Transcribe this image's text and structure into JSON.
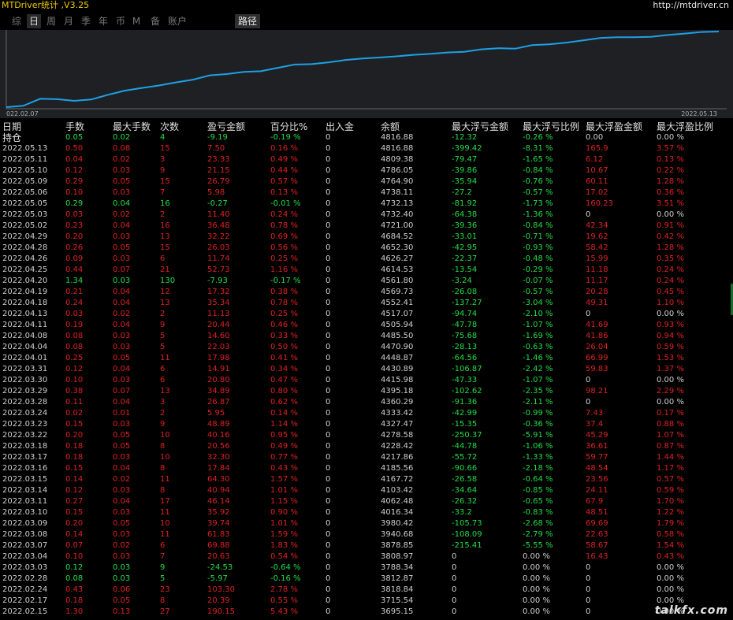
{
  "app": {
    "title": "MTDriver统计 ,V3.25",
    "site": "http://mtdriver.cn"
  },
  "tabs": [
    {
      "label": "综",
      "active": false
    },
    {
      "label": "日",
      "active": true
    },
    {
      "label": "周",
      "active": false
    },
    {
      "label": "月",
      "active": false
    },
    {
      "label": "季",
      "active": false
    },
    {
      "label": "年",
      "active": false
    },
    {
      "label": "币",
      "active": false
    },
    {
      "label": "M",
      "active": false
    },
    {
      "label": "备",
      "active": false
    },
    {
      "label": "账户",
      "active": false
    },
    {
      "label": "路径",
      "active": false
    }
  ],
  "chart_data": {
    "type": "line",
    "x_start_label": "022.02.07",
    "x_end_label": "2022.05.13",
    "line_color": "#1ea0e6",
    "background": "#1e2024",
    "values": [
      3695.15,
      3715.54,
      3818.84,
      3812.87,
      3788.34,
      3808.97,
      3878.85,
      3940.68,
      3980.42,
      4016.34,
      4062.48,
      4103.42,
      4167.72,
      4185.56,
      4217.86,
      4228.42,
      4278.58,
      4327.47,
      4333.42,
      4360.29,
      4395.18,
      4415.98,
      4430.89,
      4448.87,
      4470.9,
      4485.5,
      4505.94,
      4517.07,
      4552.41,
      4569.73,
      4561.8,
      4614.53,
      4626.27,
      4652.3,
      4684.52,
      4721.0,
      4732.4,
      4732.13,
      4738.11,
      4764.9,
      4786.05,
      4809.38,
      4816.88
    ]
  },
  "table": {
    "headers": [
      "日期",
      "手数",
      "最大手数",
      "次数",
      "盈亏金额",
      "百分比%",
      "出入金",
      "余额",
      "最大浮亏金额",
      "最大浮亏比例",
      "最大浮盈金额",
      "最大浮盈比例"
    ],
    "holding": {
      "date": "持仓",
      "lots": "0.05",
      "max_lots": "0.02",
      "count": "4",
      "pnl": "-9.19",
      "pct": "-0.19 %",
      "flow": "0",
      "balance": "4816.88",
      "max_dd": "-12.32",
      "max_dd_pct": "-0.26 %",
      "max_fp": "0.00",
      "max_fp_pct": "0.00 %",
      "sign": "neg"
    },
    "rows": [
      {
        "date": "2022.05.13",
        "lots": "0.50",
        "max_lots": "0.08",
        "count": "15",
        "pnl": "7.50",
        "pct": "0.16 %",
        "flow": "0",
        "balance": "4816.88",
        "max_dd": "-399.42",
        "max_dd_pct": "-8.31 %",
        "max_fp": "165.9",
        "max_fp_pct": "3.57 %",
        "sign": "pos",
        "fp_sign": "pos"
      },
      {
        "date": "2022.05.11",
        "lots": "0.04",
        "max_lots": "0.02",
        "count": "3",
        "pnl": "23.33",
        "pct": "0.49 %",
        "flow": "0",
        "balance": "4809.38",
        "max_dd": "-79.47",
        "max_dd_pct": "-1.65 %",
        "max_fp": "6.12",
        "max_fp_pct": "0.13 %",
        "sign": "pos",
        "fp_sign": "pos"
      },
      {
        "date": "2022.05.10",
        "lots": "0.12",
        "max_lots": "0.03",
        "count": "9",
        "pnl": "21.15",
        "pct": "0.44 %",
        "flow": "0",
        "balance": "4786.05",
        "max_dd": "-39.86",
        "max_dd_pct": "-0.84 %",
        "max_fp": "10.67",
        "max_fp_pct": "0.22 %",
        "sign": "pos",
        "fp_sign": "pos"
      },
      {
        "date": "2022.05.09",
        "lots": "0.29",
        "max_lots": "0.05",
        "count": "15",
        "pnl": "26.79",
        "pct": "0.57 %",
        "flow": "0",
        "balance": "4764.90",
        "max_dd": "-35.94",
        "max_dd_pct": "-0.76 %",
        "max_fp": "60.11",
        "max_fp_pct": "1.28 %",
        "sign": "pos",
        "fp_sign": "pos"
      },
      {
        "date": "2022.05.06",
        "lots": "0.10",
        "max_lots": "0.03",
        "count": "7",
        "pnl": "5.98",
        "pct": "0.13 %",
        "flow": "0",
        "balance": "4738.11",
        "max_dd": "-27.2",
        "max_dd_pct": "-0.57 %",
        "max_fp": "17.02",
        "max_fp_pct": "0.36 %",
        "sign": "pos",
        "fp_sign": "pos"
      },
      {
        "date": "2022.05.05",
        "lots": "0.29",
        "max_lots": "0.04",
        "count": "16",
        "pnl": "-0.27",
        "pct": "-0.01 %",
        "flow": "0",
        "balance": "4732.13",
        "max_dd": "-81.92",
        "max_dd_pct": "-1.73 %",
        "max_fp": "160.23",
        "max_fp_pct": "3.51 %",
        "sign": "neg",
        "fp_sign": "pos"
      },
      {
        "date": "2022.05.03",
        "lots": "0.03",
        "max_lots": "0.02",
        "count": "2",
        "pnl": "11.40",
        "pct": "0.24 %",
        "flow": "0",
        "balance": "4732.40",
        "max_dd": "-64.38",
        "max_dd_pct": "-1.36 %",
        "max_fp": "0",
        "max_fp_pct": "0.00 %",
        "sign": "pos",
        "fp_sign": "neu"
      },
      {
        "date": "2022.05.02",
        "lots": "0.23",
        "max_lots": "0.04",
        "count": "16",
        "pnl": "36.48",
        "pct": "0.78 %",
        "flow": "0",
        "balance": "4721.00",
        "max_dd": "-39.36",
        "max_dd_pct": "-0.84 %",
        "max_fp": "42.34",
        "max_fp_pct": "0.91 %",
        "sign": "pos",
        "fp_sign": "pos"
      },
      {
        "date": "2022.04.29",
        "lots": "0.20",
        "max_lots": "0.03",
        "count": "13",
        "pnl": "32.22",
        "pct": "0.69 %",
        "flow": "0",
        "balance": "4684.52",
        "max_dd": "-33.01",
        "max_dd_pct": "-0.71 %",
        "max_fp": "19.62",
        "max_fp_pct": "0.42 %",
        "sign": "pos",
        "fp_sign": "pos"
      },
      {
        "date": "2022.04.28",
        "lots": "0.26",
        "max_lots": "0.05",
        "count": "15",
        "pnl": "26.03",
        "pct": "0.56 %",
        "flow": "0",
        "balance": "4652.30",
        "max_dd": "-42.95",
        "max_dd_pct": "-0.93 %",
        "max_fp": "58.42",
        "max_fp_pct": "1.28 %",
        "sign": "pos",
        "fp_sign": "pos"
      },
      {
        "date": "2022.04.26",
        "lots": "0.09",
        "max_lots": "0.03",
        "count": "6",
        "pnl": "11.74",
        "pct": "0.25 %",
        "flow": "0",
        "balance": "4626.27",
        "max_dd": "-22.37",
        "max_dd_pct": "-0.48 %",
        "max_fp": "15.99",
        "max_fp_pct": "0.35 %",
        "sign": "pos",
        "fp_sign": "pos"
      },
      {
        "date": "2022.04.25",
        "lots": "0.44",
        "max_lots": "0.07",
        "count": "21",
        "pnl": "52.73",
        "pct": "1.16 %",
        "flow": "0",
        "balance": "4614.53",
        "max_dd": "-13.54",
        "max_dd_pct": "-0.29 %",
        "max_fp": "11.18",
        "max_fp_pct": "0.24 %",
        "sign": "pos",
        "fp_sign": "pos"
      },
      {
        "date": "2022.04.20",
        "lots": "1.34",
        "max_lots": "0.03",
        "count": "130",
        "pnl": "-7.93",
        "pct": "-0.17 %",
        "flow": "0",
        "balance": "4561.80",
        "max_dd": "-3.24",
        "max_dd_pct": "-0.07 %",
        "max_fp": "11.17",
        "max_fp_pct": "0.24 %",
        "sign": "neg",
        "fp_sign": "pos"
      },
      {
        "date": "2022.04.19",
        "lots": "0.21",
        "max_lots": "0.04",
        "count": "12",
        "pnl": "17.32",
        "pct": "0.38 %",
        "flow": "0",
        "balance": "4569.73",
        "max_dd": "-26.08",
        "max_dd_pct": "-0.57 %",
        "max_fp": "20.28",
        "max_fp_pct": "0.45 %",
        "sign": "pos",
        "fp_sign": "pos"
      },
      {
        "date": "2022.04.18",
        "lots": "0.24",
        "max_lots": "0.04",
        "count": "13",
        "pnl": "35.34",
        "pct": "0.78 %",
        "flow": "0",
        "balance": "4552.41",
        "max_dd": "-137.27",
        "max_dd_pct": "-3.04 %",
        "max_fp": "49.31",
        "max_fp_pct": "1.10 %",
        "sign": "pos",
        "fp_sign": "pos"
      },
      {
        "date": "2022.04.13",
        "lots": "0.03",
        "max_lots": "0.02",
        "count": "2",
        "pnl": "11.13",
        "pct": "0.25 %",
        "flow": "0",
        "balance": "4517.07",
        "max_dd": "-94.74",
        "max_dd_pct": "-2.10 %",
        "max_fp": "0",
        "max_fp_pct": "0.00 %",
        "sign": "pos",
        "fp_sign": "neu"
      },
      {
        "date": "2022.04.11",
        "lots": "0.19",
        "max_lots": "0.04",
        "count": "9",
        "pnl": "20.44",
        "pct": "0.46 %",
        "flow": "0",
        "balance": "4505.94",
        "max_dd": "-47.78",
        "max_dd_pct": "-1.07 %",
        "max_fp": "41.69",
        "max_fp_pct": "0.93 %",
        "sign": "pos",
        "fp_sign": "pos"
      },
      {
        "date": "2022.04.08",
        "lots": "0.08",
        "max_lots": "0.03",
        "count": "5",
        "pnl": "14.60",
        "pct": "0.33 %",
        "flow": "0",
        "balance": "4485.50",
        "max_dd": "-75.68",
        "max_dd_pct": "-1.69 %",
        "max_fp": "41.86",
        "max_fp_pct": "0.94 %",
        "sign": "pos",
        "fp_sign": "pos"
      },
      {
        "date": "2022.04.04",
        "lots": "0.08",
        "max_lots": "0.03",
        "count": "5",
        "pnl": "22.03",
        "pct": "0.50 %",
        "flow": "0",
        "balance": "4470.90",
        "max_dd": "-28.13",
        "max_dd_pct": "-0.63 %",
        "max_fp": "26.04",
        "max_fp_pct": "0.59 %",
        "sign": "pos",
        "fp_sign": "pos"
      },
      {
        "date": "2022.04.01",
        "lots": "0.25",
        "max_lots": "0.05",
        "count": "11",
        "pnl": "17.98",
        "pct": "0.41 %",
        "flow": "0",
        "balance": "4448.87",
        "max_dd": "-64.56",
        "max_dd_pct": "-1.46 %",
        "max_fp": "66.99",
        "max_fp_pct": "1.53 %",
        "sign": "pos",
        "fp_sign": "pos"
      },
      {
        "date": "2022.03.31",
        "lots": "0.12",
        "max_lots": "0.04",
        "count": "6",
        "pnl": "14.91",
        "pct": "0.34 %",
        "flow": "0",
        "balance": "4430.89",
        "max_dd": "-106.87",
        "max_dd_pct": "-2.42 %",
        "max_fp": "59.83",
        "max_fp_pct": "1.37 %",
        "sign": "pos",
        "fp_sign": "pos"
      },
      {
        "date": "2022.03.30",
        "lots": "0.10",
        "max_lots": "0.03",
        "count": "6",
        "pnl": "20.80",
        "pct": "0.47 %",
        "flow": "0",
        "balance": "4415.98",
        "max_dd": "-47.33",
        "max_dd_pct": "-1.07 %",
        "max_fp": "0",
        "max_fp_pct": "0.00 %",
        "sign": "pos",
        "fp_sign": "neu"
      },
      {
        "date": "2022.03.29",
        "lots": "0.38",
        "max_lots": "0.07",
        "count": "13",
        "pnl": "34.89",
        "pct": "0.80 %",
        "flow": "0",
        "balance": "4395.18",
        "max_dd": "-102.62",
        "max_dd_pct": "-2.35 %",
        "max_fp": "98.21",
        "max_fp_pct": "2.29 %",
        "sign": "pos",
        "fp_sign": "pos"
      },
      {
        "date": "2022.03.28",
        "lots": "0.11",
        "max_lots": "0.04",
        "count": "3",
        "pnl": "26.87",
        "pct": "0.62 %",
        "flow": "0",
        "balance": "4360.29",
        "max_dd": "-91.36",
        "max_dd_pct": "-2.11 %",
        "max_fp": "0",
        "max_fp_pct": "0.00 %",
        "sign": "pos",
        "fp_sign": "neu"
      },
      {
        "date": "2022.03.24",
        "lots": "0.02",
        "max_lots": "0.01",
        "count": "2",
        "pnl": "5.95",
        "pct": "0.14 %",
        "flow": "0",
        "balance": "4333.42",
        "max_dd": "-42.99",
        "max_dd_pct": "-0.99 %",
        "max_fp": "7.43",
        "max_fp_pct": "0.17 %",
        "sign": "pos",
        "fp_sign": "pos"
      },
      {
        "date": "2022.03.23",
        "lots": "0.15",
        "max_lots": "0.03",
        "count": "9",
        "pnl": "48.89",
        "pct": "1.14 %",
        "flow": "0",
        "balance": "4327.47",
        "max_dd": "-15.35",
        "max_dd_pct": "-0.36 %",
        "max_fp": "37.4",
        "max_fp_pct": "0.88 %",
        "sign": "pos",
        "fp_sign": "pos"
      },
      {
        "date": "2022.03.22",
        "lots": "0.20",
        "max_lots": "0.05",
        "count": "10",
        "pnl": "40.16",
        "pct": "0.95 %",
        "flow": "0",
        "balance": "4278.58",
        "max_dd": "-250.37",
        "max_dd_pct": "-5.91 %",
        "max_fp": "45.29",
        "max_fp_pct": "1.07 %",
        "sign": "pos",
        "fp_sign": "pos"
      },
      {
        "date": "2022.03.18",
        "lots": "0.18",
        "max_lots": "0.05",
        "count": "8",
        "pnl": "20.56",
        "pct": "0.49 %",
        "flow": "0",
        "balance": "4228.42",
        "max_dd": "-44.78",
        "max_dd_pct": "-1.06 %",
        "max_fp": "36.61",
        "max_fp_pct": "0.87 %",
        "sign": "pos",
        "fp_sign": "pos"
      },
      {
        "date": "2022.03.17",
        "lots": "0.18",
        "max_lots": "0.03",
        "count": "10",
        "pnl": "32.30",
        "pct": "0.77 %",
        "flow": "0",
        "balance": "4217.86",
        "max_dd": "-55.72",
        "max_dd_pct": "-1.33 %",
        "max_fp": "59.77",
        "max_fp_pct": "1.44 %",
        "sign": "pos",
        "fp_sign": "pos"
      },
      {
        "date": "2022.03.16",
        "lots": "0.15",
        "max_lots": "0.04",
        "count": "8",
        "pnl": "17.84",
        "pct": "0.43 %",
        "flow": "0",
        "balance": "4185.56",
        "max_dd": "-90.66",
        "max_dd_pct": "-2.18 %",
        "max_fp": "48.54",
        "max_fp_pct": "1.17 %",
        "sign": "pos",
        "fp_sign": "pos"
      },
      {
        "date": "2022.03.15",
        "lots": "0.14",
        "max_lots": "0.02",
        "count": "11",
        "pnl": "64.30",
        "pct": "1.57 %",
        "flow": "0",
        "balance": "4167.72",
        "max_dd": "-26.58",
        "max_dd_pct": "-0.64 %",
        "max_fp": "23.56",
        "max_fp_pct": "0.57 %",
        "sign": "pos",
        "fp_sign": "pos"
      },
      {
        "date": "2022.03.14",
        "lots": "0.12",
        "max_lots": "0.03",
        "count": "8",
        "pnl": "40.94",
        "pct": "1.01 %",
        "flow": "0",
        "balance": "4103.42",
        "max_dd": "-34.64",
        "max_dd_pct": "-0.85 %",
        "max_fp": "24.11",
        "max_fp_pct": "0.59 %",
        "sign": "pos",
        "fp_sign": "pos"
      },
      {
        "date": "2022.03.11",
        "lots": "0.27",
        "max_lots": "0.04",
        "count": "17",
        "pnl": "46.14",
        "pct": "1.15 %",
        "flow": "0",
        "balance": "4062.48",
        "max_dd": "-26.32",
        "max_dd_pct": "-0.65 %",
        "max_fp": "67.9",
        "max_fp_pct": "1.70 %",
        "sign": "pos",
        "fp_sign": "pos"
      },
      {
        "date": "2022.03.10",
        "lots": "0.15",
        "max_lots": "0.03",
        "count": "11",
        "pnl": "35.92",
        "pct": "0.90 %",
        "flow": "0",
        "balance": "4016.34",
        "max_dd": "-33.2",
        "max_dd_pct": "-0.83 %",
        "max_fp": "48.51",
        "max_fp_pct": "1.22 %",
        "sign": "pos",
        "fp_sign": "pos"
      },
      {
        "date": "2022.03.09",
        "lots": "0.20",
        "max_lots": "0.05",
        "count": "10",
        "pnl": "39.74",
        "pct": "1.01 %",
        "flow": "0",
        "balance": "3980.42",
        "max_dd": "-105.73",
        "max_dd_pct": "-2.68 %",
        "max_fp": "69.69",
        "max_fp_pct": "1.79 %",
        "sign": "pos",
        "fp_sign": "pos"
      },
      {
        "date": "2022.03.08",
        "lots": "0.14",
        "max_lots": "0.03",
        "count": "11",
        "pnl": "61.83",
        "pct": "1.59 %",
        "flow": "0",
        "balance": "3940.68",
        "max_dd": "-108.09",
        "max_dd_pct": "-2.79 %",
        "max_fp": "22.63",
        "max_fp_pct": "0.58 %",
        "sign": "pos",
        "fp_sign": "pos"
      },
      {
        "date": "2022.03.07",
        "lots": "0.07",
        "max_lots": "0.02",
        "count": "6",
        "pnl": "69.88",
        "pct": "1.83 %",
        "flow": "0",
        "balance": "3878.85",
        "max_dd": "-215.41",
        "max_dd_pct": "-5.55 %",
        "max_fp": "58.67",
        "max_fp_pct": "1.54 %",
        "sign": "pos",
        "fp_sign": "pos"
      },
      {
        "date": "2022.03.04",
        "lots": "0.10",
        "max_lots": "0.03",
        "count": "7",
        "pnl": "20.63",
        "pct": "0.54 %",
        "flow": "0",
        "balance": "3808.97",
        "max_dd": "0",
        "max_dd_pct": "0.00 %",
        "max_fp": "16.43",
        "max_fp_pct": "0.43 %",
        "sign": "pos",
        "fp_sign": "pos",
        "dd_sign": "neu"
      },
      {
        "date": "2022.03.03",
        "lots": "0.12",
        "max_lots": "0.03",
        "count": "9",
        "pnl": "-24.53",
        "pct": "-0.64 %",
        "flow": "0",
        "balance": "3788.34",
        "max_dd": "0",
        "max_dd_pct": "0.00 %",
        "max_fp": "0",
        "max_fp_pct": "0.00 %",
        "sign": "neg",
        "fp_sign": "neu",
        "dd_sign": "neu"
      },
      {
        "date": "2022.02.28",
        "lots": "0.08",
        "max_lots": "0.03",
        "count": "5",
        "pnl": "-5.97",
        "pct": "-0.16 %",
        "flow": "0",
        "balance": "3812.87",
        "max_dd": "0",
        "max_dd_pct": "0.00 %",
        "max_fp": "0",
        "max_fp_pct": "0.00 %",
        "sign": "neg",
        "fp_sign": "neu",
        "dd_sign": "neu"
      },
      {
        "date": "2022.02.24",
        "lots": "0.43",
        "max_lots": "0.06",
        "count": "23",
        "pnl": "103.30",
        "pct": "2.78 %",
        "flow": "0",
        "balance": "3818.84",
        "max_dd": "0",
        "max_dd_pct": "0.00 %",
        "max_fp": "0",
        "max_fp_pct": "0.00 %",
        "sign": "pos",
        "fp_sign": "neu",
        "dd_sign": "neu"
      },
      {
        "date": "2022.02.17",
        "lots": "0.18",
        "max_lots": "0.05",
        "count": "8",
        "pnl": "20.39",
        "pct": "0.55 %",
        "flow": "0",
        "balance": "3715.54",
        "max_dd": "0",
        "max_dd_pct": "0.00 %",
        "max_fp": "0",
        "max_fp_pct": "0.00 %",
        "sign": "pos",
        "fp_sign": "neu",
        "dd_sign": "neu"
      },
      {
        "date": "2022.02.15",
        "lots": "1.30",
        "max_lots": "0.13",
        "count": "27",
        "pnl": "190.15",
        "pct": "5.43 %",
        "flow": "0",
        "balance": "3695.15",
        "max_dd": "0",
        "max_dd_pct": "0.00 %",
        "max_fp": "0",
        "max_fp_pct": "0.00 %",
        "sign": "pos",
        "fp_sign": "neu",
        "dd_sign": "neu"
      }
    ]
  },
  "watermark": "talkfx.com"
}
